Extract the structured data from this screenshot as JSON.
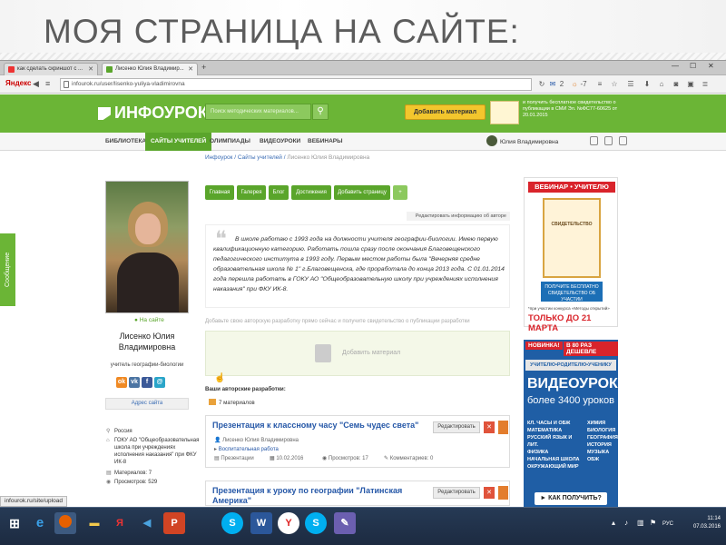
{
  "slide": {
    "title": "МОЯ СТРАНИЦА НА САЙТЕ:"
  },
  "browser": {
    "tabs": [
      {
        "label": "как сделать скриншот с ..."
      },
      {
        "label": "Лисенко Юлия Владимир..."
      }
    ],
    "yandex": "Яндекс",
    "url": "infourok.ru/user/lisenko-yuliya-vladimirovna",
    "toolbar_badges": [
      "2",
      "-7"
    ]
  },
  "site": {
    "logo": "ИНФОУРОК",
    "search_placeholder": "Поиск методических материалов...",
    "add_material": "Добавить материал",
    "promo": "и получить бесплатное свидетельство о публикации в СМИ Эл. №ФС77-60625 от 20.01.2015",
    "menu": [
      "БИБЛИОТЕКА",
      "САЙТЫ УЧИТЕЛЕЙ",
      "ОЛИМПИАДЫ",
      "ВИДЕОУРОКИ",
      "ВЕБИНАРЫ"
    ],
    "user_name": "Юлия Владимировна",
    "breadcrumb": {
      "home": "Инфоурок",
      "sep1": " / ",
      "section": "Сайты учителей",
      "sep2": " / ",
      "current": "Лисенко Юлия Владимировна"
    }
  },
  "side_tab": "Сообщение",
  "profile": {
    "online": "● На сайте",
    "name": "Лисенко Юлия Владимировна",
    "job": "учитель географии-биологии",
    "socials": [
      "ok",
      "vk",
      "f",
      "@"
    ],
    "site_address": "Адрес сайта",
    "country": "Россия",
    "school": "ГОКУ АО \"Общеобразовательная школа при учреждениях исполнения наказания\" при ФКУ ИК-8",
    "materials": "Материалов: 7",
    "views": "Просмотров: 529"
  },
  "page_tabs": [
    "Главная",
    "Галерея",
    "Блог",
    "Достижения",
    "Добавить страницу",
    "+"
  ],
  "edit_author": "Редактировать информацию об авторе",
  "about_text": "В школе работаю с 1993 года на должности учителя географии-биологии. Имею первую квалификационную категорию. Работать пошла сразу после окончания Благовещенского педагогического института в 1993 году. Первым местом работы была \"Вечерняя средне образовательная школа № 1\" г.Благовещенска, где проработала до конца 2013 года. С 01.01.2014 года перешла работать в ГОКУ АО \"Общеобразовательную школу при учреждениях исполнения наказания\" при ФКУ ИК-8.",
  "upload_hint": "Добавьте свою авторскую разработку прямо сейчас и получите свидетельство о публикации разработки",
  "upload_label": "Добавить материал",
  "works_title": "Ваши авторские разработки:",
  "works_count": "7 материалов",
  "works": [
    {
      "title": "Презентация к классному часу \"Семь чудес света\"",
      "edit": "Редактировать",
      "author": "Лисенко Юлия Владимировна",
      "category": "Воспитательная работа",
      "type": "Презентации",
      "date": "10.02.2016",
      "views": "Просмотров: 17",
      "comments": "Комментариев: 0"
    },
    {
      "title": "Презентация к уроку по географии \"Латинская Америка\"",
      "edit": "Редактировать"
    }
  ],
  "ad1": {
    "header": "ВЕБИНАР • УЧИТЕЛЮ",
    "cert": "СВИДЕТЕЛЬСТВО",
    "free": "ПОЛУЧИТЕ БЕСПЛАТНО СВИДЕТЕЛЬСТВО ОБ УЧАСТИИ",
    "small": "*при участии конкурса «Методы открытий»",
    "till": "ТОЛЬКО ДО 21 МАРТА"
  },
  "ad2": {
    "new": "НОВИНКА!",
    "cheaper": "В 80 РАЗ ДЕШЕВЛЕ",
    "trio": "УЧИТЕЛЮ•РОДИТЕЛЮ•УЧЕНИКУ",
    "video": "ВИДЕОУРОКИ",
    "more": "более 3400 уроков",
    "subjects_left": [
      "КЛ. ЧАСЫ И ОБЖ",
      "МАТЕМАТИКА",
      "РУССКИЙ ЯЗЫК И ЛИТ.",
      "ФИЗИКА",
      "НАЧАЛЬНАЯ ШКОЛА",
      "ОКРУЖАЮЩИЙ МИР"
    ],
    "subjects_right": [
      "ХИМИЯ",
      "БИОЛОГИЯ",
      "ГЕОГРАФИЯ",
      "ИСТОРИЯ",
      "МУЗЫКА",
      "ОБЖ"
    ],
    "how": "► КАК ПОЛУЧИТЬ?"
  },
  "status_url": "infourok.ru/site/upload",
  "taskbar": {
    "lang": "РУС",
    "time": "11:14",
    "date": "07.03.2016"
  }
}
